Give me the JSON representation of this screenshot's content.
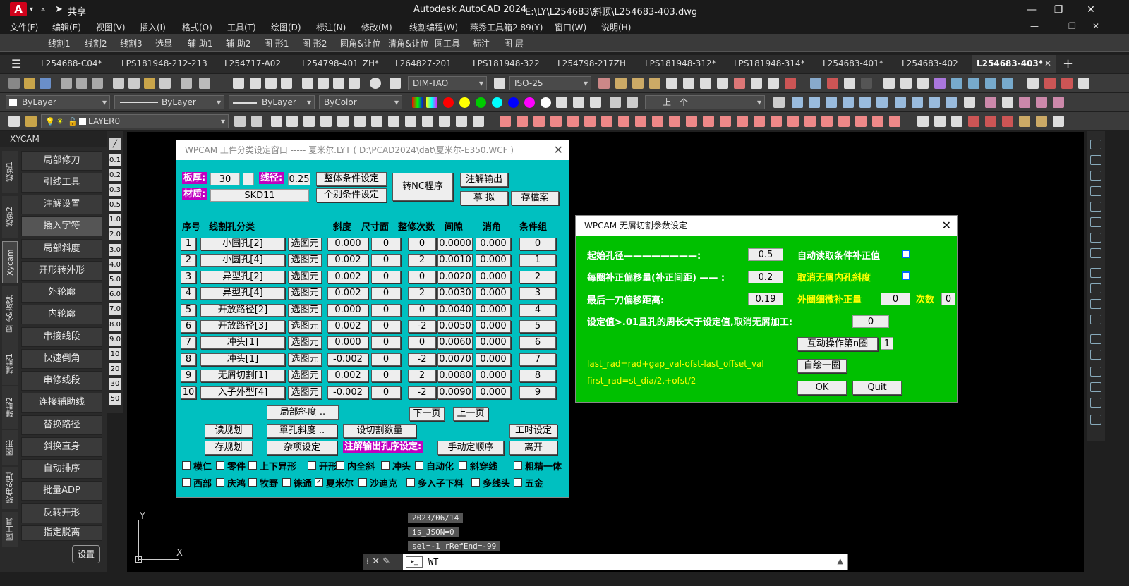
{
  "app": {
    "logo": "A",
    "share": "共享",
    "title": "Autodesk AutoCAD 2024",
    "path": "E:\\LY\\L254683\\斜顶\\L254683-403.dwg"
  },
  "menu": [
    "文件(F)",
    "编辑(E)",
    "视图(V)",
    "插入(I)",
    "格式(O)",
    "工具(T)",
    "绘图(D)",
    "标注(N)",
    "修改(M)",
    "线割编程(W)",
    "燕秀工具箱2.89(Y)",
    "窗口(W)",
    "说明(H)"
  ],
  "menu2": [
    "线割1",
    "线割2",
    "线割3",
    "选显",
    "辅 助1",
    "辅 助2",
    "图 形1",
    "图 形2",
    "圆角&让位",
    "清角&让位",
    "圆工具",
    "标注",
    "图 层"
  ],
  "tabs": [
    "L254688-C04*",
    "LPS181948-212-213",
    "L254717-A02",
    "L254798-401_ZH*",
    "L264827-201",
    "LPS181948-322",
    "L254798-217ZH",
    "LPS181948-312*",
    "LPS181948-314*",
    "L254683-401*",
    "L254683-402",
    "L254683-403*"
  ],
  "toolbar": {
    "dimstyle": "DIM-TAO",
    "dimscale": "ISO-25",
    "color": "ByLayer",
    "linetype": "ByLayer",
    "lineweight": "ByLayer",
    "plotstyle": "ByColor",
    "layer_prev": "上一个",
    "layer": "LAYER0"
  },
  "left_panel": {
    "title": "XYCAM",
    "vtabs": [
      "线割1",
      "线割2",
      "Xycam",
      "显示&选择",
      "辅助1",
      "辅助2",
      "图形",
      "转角处理",
      "圆工具"
    ],
    "buttons": [
      "局部修刀",
      "引线工具",
      "注解设置",
      "插入字符",
      "局部斜度",
      "开形转外形",
      "外轮廓",
      "内轮廓",
      "串接线段",
      "快速倒角",
      "串修线段",
      "连接辅助线",
      "替换路径",
      "斜换直身",
      "自动排序",
      "批量ADP",
      "反转开形",
      "指定脱离"
    ],
    "settings": "设置"
  },
  "num_strip": [
    "0.1",
    "0.2",
    "0.3",
    "0.5",
    "1.0",
    "2.0",
    "3.0",
    "4.0",
    "5.0",
    "6.0",
    "7.0",
    "8.0",
    "9.0",
    "10",
    "20",
    "30",
    "50"
  ],
  "dlg1": {
    "title": "WPCAM 工件分类设定窗口 ----- 夏米尔.LYT ( D:\\PCAD2024\\dat\\夏米尔-E350.WCF )",
    "thick_label": "板厚:",
    "thick": "30",
    "wire_label": "线径:",
    "wire": "0.25",
    "mat_label": "材质:",
    "material": "SKD11",
    "btn_all": "整体条件设定",
    "btn_each": "个别条件设定",
    "btn_nc": "转NC程序",
    "btn_note": "注解输出",
    "btn_sim": "摹 拟",
    "btn_save": "存檔案",
    "headers": [
      "序号",
      "线割孔分类",
      "斜度",
      "尺寸面",
      "整修次数",
      "间隙",
      "消角",
      "条件组"
    ],
    "select_label": "选图元",
    "rows": [
      [
        "1",
        "小圆孔[2]",
        "0.000",
        "0",
        "0",
        "0.0000",
        "0.000",
        "0"
      ],
      [
        "2",
        "小圆孔[4]",
        "0.002",
        "0",
        "2",
        "0.0010",
        "0.000",
        "1"
      ],
      [
        "3",
        "异型孔[2]",
        "0.002",
        "0",
        "0",
        "0.0020",
        "0.000",
        "2"
      ],
      [
        "4",
        "异型孔[4]",
        "0.002",
        "0",
        "2",
        "0.0030",
        "0.000",
        "3"
      ],
      [
        "5",
        "开放路径[2]",
        "0.000",
        "0",
        "0",
        "0.0040",
        "0.000",
        "4"
      ],
      [
        "6",
        "开放路径[3]",
        "0.002",
        "0",
        "-2",
        "0.0050",
        "0.000",
        "5"
      ],
      [
        "7",
        "冲头[1]",
        "0.000",
        "0",
        "0",
        "0.0060",
        "0.000",
        "6"
      ],
      [
        "8",
        "冲头[1]",
        "-0.002",
        "0",
        "-2",
        "0.0070",
        "0.000",
        "7"
      ],
      [
        "9",
        "无屑切割[1]",
        "0.002",
        "0",
        "2",
        "0.0080",
        "0.000",
        "8"
      ],
      [
        "10",
        "入子外型[4]",
        "-0.002",
        "0",
        "-2",
        "0.0090",
        "0.000",
        "9"
      ]
    ],
    "btn_local": "局部斜度 ..",
    "btn_next": "下一页",
    "btn_prev": "上一页",
    "btn_read": "读规划",
    "btn_single": "單孔斜度 ..",
    "btn_count": "设切割数量",
    "btn_time": "工时设定",
    "btn_store": "存规划",
    "btn_misc": "杂项设定",
    "note_order": "注解输出孔序设定:",
    "btn_manual": "手动定顺序",
    "btn_exit": "离开",
    "checks1": [
      "模仁",
      "零件",
      "上下异形",
      "开形",
      "内全斜",
      "冲头",
      "自动化",
      "斜穿线",
      "粗精一体"
    ],
    "checks2": [
      "西部",
      "庆鸿",
      "牧野",
      "徕通",
      "夏米尔",
      "沙迪克",
      "多入子下料",
      "多线头",
      "五金"
    ]
  },
  "dlg2": {
    "title": "WPCAM 无屑切割参数设定",
    "l1": "起始孔径————————:",
    "v1": "0.5",
    "l2": "每圈补正偏移量(补正间距) —— :",
    "v2": "0.2",
    "l3": "最后一刀偏移距离:",
    "v3": "0.19",
    "y1": "自动读取条件补正值",
    "y2": "取消无屑内孔斜度",
    "y3": "外圈细微补正量",
    "y3v": "0",
    "y4": "次数",
    "y4v": "0",
    "l4": "设定值>.01且孔的周长大于设定值,取消无屑加工:",
    "v4": "0",
    "btn_inter": "互动操作第n圈",
    "inter_v": "1",
    "f1": "last_rad=rad+gap_val-ofst-last_offset_val",
    "f2": "first_rad=st_dia/2.+ofst/2",
    "btn_draw": "自绘一圈",
    "ok": "OK",
    "quit": "Quit"
  },
  "cmd": {
    "h1": "2023/06/14",
    "h2": "is_JSON=0",
    "h3": "sel=-1 rRefEnd=-99",
    "input": "WT"
  },
  "ucs": {
    "x": "X",
    "y": "Y"
  }
}
